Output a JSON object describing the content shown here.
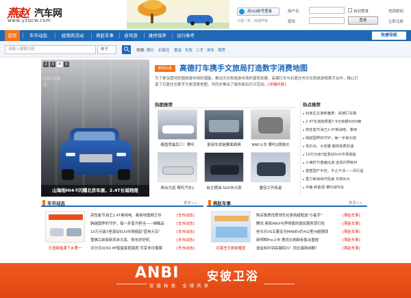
{
  "header": {
    "logo_cn": "燕赵",
    "logo_main": "汽车网",
    "logo_url": "www.yzqcw.com",
    "qq_login": "用QQ帐号登录",
    "qq_hint": "只需一步，快速开始",
    "user_label": "用户名",
    "password_label": "密码",
    "autologin_label": "自动登录",
    "login_button": "登录",
    "find_password": "找回密码",
    "register": "立即注册"
  },
  "nav": {
    "items": [
      "首页",
      "车市动态",
      "经销商活动",
      "燕赵车事",
      "自驾游",
      "維修保养",
      "出行参考"
    ],
    "quick_nav": "快捷导航"
  },
  "search": {
    "placeholder": "请输入搜索内容",
    "select_value": "帖子",
    "hot_label": "热搜:",
    "hot_tags": [
      "限行",
      "石家庄",
      "黄金",
      "车险",
      "二手",
      "用车",
      "保养"
    ]
  },
  "slider": {
    "numbers": [
      "2",
      "3",
      "4",
      "5"
    ],
    "active_index": 2,
    "left_text": "中国·石家庄",
    "caption": "山海炮HI4-T闪耀北京车展，2.4T长城炮限"
  },
  "headline": {
    "badge": "新闻头条",
    "title": "高德打车携手文旅局打造数字消费地图",
    "desc": "为了更深度地挖掘旅游市场的潜能，推动文化和旅游市场的蓬勃发展，高德打车与石家庄市文化和旅游局携手合作，精心打造了石家庄在数字文旅消费地图，并同步推出了城市新玩乐日活动。",
    "more": "[详细内容]"
  },
  "hot_recommend": {
    "title": "热图推荐",
    "items": [
      "泰国竞最后三！哪吒",
      "家用车就是要面面俱",
      "NNP上车 哪吒S两款价",
      "再出大招 哪吒汽车1",
      "自主燃油 SUV市占率",
      "雷佳兰开拓者"
    ]
  },
  "hot_points": {
    "title": "热点推荐",
    "items": [
      "石家庄文旅新魔景：高德打车携",
      "2.4T长城炮限量7.9元惊爆5000辆",
      "高性能节油王2.4T柴油电、乘用",
      "跨越国界的守护，每一步皆为担",
      "低价出、大容量 飘效钜质抗谣",
      "10万元级7座混动SUV市场掀起",
      "小满时节香曦出游 选择问界新M",
      "重塑国产半挂，不止于详——风行星",
      "重力新纳纬开拓者 共筑AI大",
      "平静·新能源 哪吒城市车"
    ]
  },
  "news_section": {
    "title": "车市动态",
    "more": "更多>>",
    "promo_caption": "打造新能源下乡第一",
    "lines": [
      "高性能节油王2.4T乘用电、乘用地盘拥王夺",
      "跨越国界的守护，每一步皆为担当——继甄品",
      "10万元级7座混动SUV市场掀起\"蓝电元买\"",
      "雪佛兰新款新风米大亮、购车好好机",
      "沃尔沃XC60 PP智能家庭豪庭 尽享非日爆爆"
    ],
    "tags": [
      "[车市动态]",
      "[车市动态]",
      "[车市动态]",
      "[车市动态]",
      "[车市动态]"
    ]
  },
  "story_section": {
    "title": "燕赵车事",
    "more": "更多>>",
    "promo_caption": "石家庄文旅新魔景",
    "lines": [
      "购买极质优质领先化身商超配送\"小能手\"",
      "腾讯:奥拓MAX与停得家的便民服务现打权",
      "老头乐VS五菱宏光MINIEV仍4公里/H超德西",
      "新明明Pro上市 携优价刷新标售出重抛",
      "追金标中到高端四川！同比最新纳鲸！"
    ],
    "tags": [
      "[燕赵车事]",
      "[燕赵车事]",
      "[燕赵车事]",
      "[燕赵车事]",
      "[燕赵车事]"
    ]
  },
  "ad": {
    "logo": "ANBI",
    "name_cn": "安彼卫浴",
    "slogan": "安彼标准 全球共享"
  },
  "colors": {
    "nav_blue": "#1f68b5",
    "accent_orange": "#f2761b",
    "brand_red": "#d81e06",
    "ad_orange": "#e84e18"
  }
}
